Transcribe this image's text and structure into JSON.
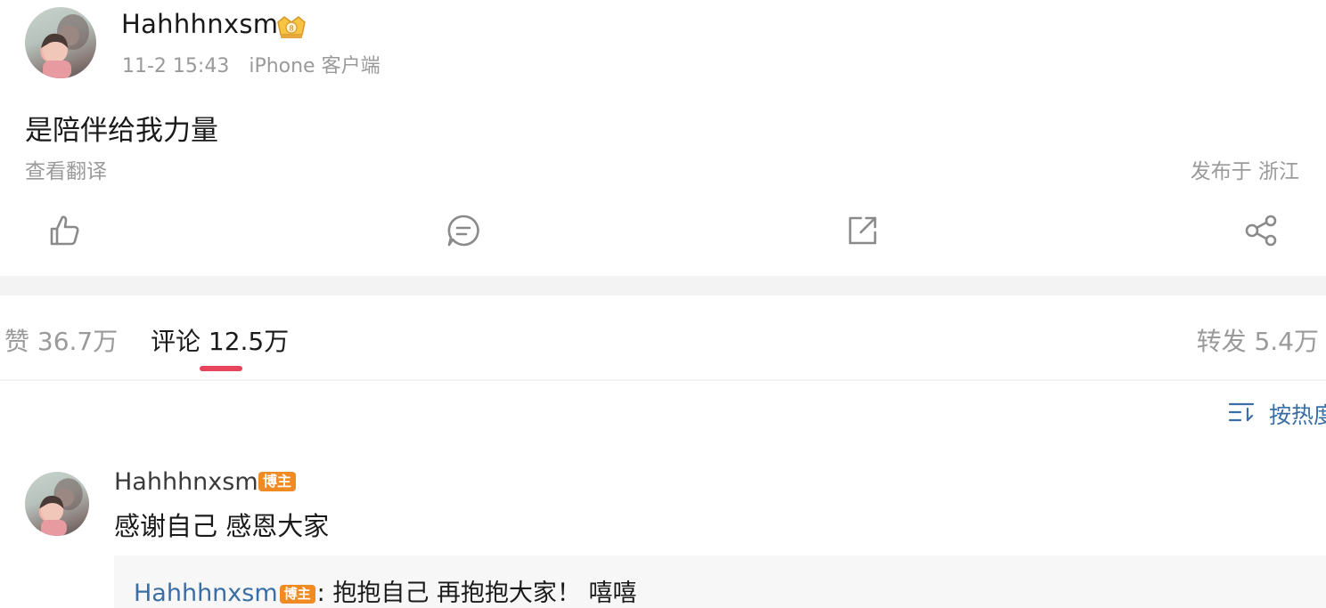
{
  "post": {
    "author": "Hahhhnxsm",
    "date": "11-2 15:43",
    "client": "iPhone 客户端",
    "text": "是陪伴给我力量",
    "translate": "查看翻译",
    "location": "发布于 浙江"
  },
  "actions": [
    {
      "icon": "thumbs-up-icon"
    },
    {
      "icon": "comment-bubble-icon"
    },
    {
      "icon": "repost-icon"
    },
    {
      "icon": "share-icon"
    }
  ],
  "tabs": {
    "likes": "赞 36.7万",
    "comments": "评论 12.5万",
    "reposts": "转发 5.4万"
  },
  "sort": {
    "label": "按热度",
    "icon": "sort-icon"
  },
  "comment": {
    "author": "Hahhhnxsm",
    "badge": "博主",
    "text": "感谢自己 感恩大家",
    "reply": {
      "author": "Hahhhnxsm",
      "badge": "博主",
      "text": ": 抱抱自己 再抱抱大家！ 嘻嘻"
    }
  },
  "colors": {
    "link": "#3a6ea5",
    "accent": "#e8455c",
    "badge": "#f08a22",
    "muted": "#9a9a9a"
  }
}
